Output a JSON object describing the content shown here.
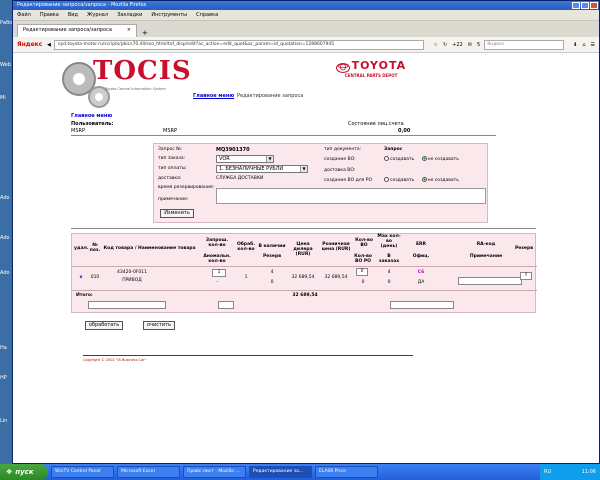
{
  "desktop": {
    "icons": [
      "Рабо",
      "Web",
      "Mi",
      "Ado",
      "Ado",
      "Ado",
      "На",
      "HP",
      "Lin"
    ]
  },
  "window": {
    "title": "Редактирование запроса/запроса - Mozilla Firefox"
  },
  "menu": [
    "Файл",
    "Правка",
    "Вид",
    "Журнал",
    "Закладки",
    "Инструменты",
    "Справка"
  ],
  "tab": {
    "label": "Редактирование запроса/запроса",
    "close": "×",
    "plus": "+"
  },
  "urlbar": {
    "logo": "Яндекс",
    "url": "cpd.toyota-motor.ru/scripts/pbics70.dll/sso_html/tof_disp/edit?ac_action=edit_quot&ac_param=id_quotation=1288607945",
    "count1": "+22",
    "count2": "5",
    "search_placeholder": "Яндекс"
  },
  "header": {
    "tocis": "TOCIS",
    "tocis_sub": "Toyota Central Information System",
    "toyota": "TOYOTA",
    "toyota_sub": "CENTRAL PARTS DEPOT",
    "nav_main": "Главное меню",
    "nav_edit": "Редактирование запроса"
  },
  "info": {
    "page_heading": "Главное меню",
    "users_label": "Пользователь:",
    "msrp_a": "MSRP",
    "msrp_b": "MSRP",
    "account_label": "Состояние лиц.счета",
    "account_value": "0,00"
  },
  "form": {
    "req_no_label": "Запрос №:",
    "req_no_value": "MQ3901370",
    "order_type_label": "тип заказа:",
    "order_type_value": "VOR",
    "payment_label": "тип оплаты:",
    "payment_value": "1. БЕЗНАЛИЧНЫЕ РУБЛИ",
    "delivery_label": "доставка:",
    "delivery_value": "СЛУЖБА ДОСТАВКИ",
    "reserve_time_label": "время резервирования:",
    "note_label": "примечание:",
    "doc_type_label": "тип документа:",
    "request_header": "Запрос",
    "created_bo_label": "создание ВО:",
    "delivery_bo_label": "доставка ВО:",
    "created_bo_po_label": "создание ВО для PO",
    "radio_create": "создавать",
    "radio_no_create": "не создавать",
    "change_button": "Изменить"
  },
  "table": {
    "headers": {
      "del": "удал.",
      "pos": "№ поз.",
      "code": "Код товара / Наименование товара",
      "req_qty": "Запрош. кол-во",
      "absent_qty": "Аномальн. кол-во",
      "proc_qty": "Обраб. кол-во",
      "available": "В наличии",
      "reserve": "Резерв",
      "price_dealer": "Цена дилера (RUR)",
      "retail_price": "Розничная цена (RUR)",
      "qty_bo": "Кол-во ВО",
      "qty_bo_po": "Кол-во ВО PO",
      "max_qty": "Max кол-во (день)",
      "in_order": "В заказах",
      "err": "ERR",
      "offc": "Офиц.",
      "ra_code": "RA-код",
      "note": "Примечание",
      "reserve2": "Резерв"
    },
    "row": {
      "del": "x",
      "pos": "010",
      "code": "43420-0F011",
      "name": "ПРИВОД",
      "req_qty": "1",
      "absent_qty": "-",
      "proc_qty": "1",
      "available": "4",
      "reserve": "0",
      "price_dealer": "32 689,54",
      "retail_price": "32 689,54",
      "qty_bo": "0",
      "qty_bo_po": "0",
      "max_qty": "4",
      "in_order": "0",
      "err": "C6",
      "offc": "ДА",
      "btn": "!"
    },
    "total_label": "Итого:",
    "total_value": "32 689,54"
  },
  "actions": {
    "process": "обработать",
    "clear": "очистить"
  },
  "footer": {
    "copyright": "Copyright © 2002 \"IA Business Car\""
  },
  "taskbar": {
    "start": "пуск",
    "tasks": [
      "WinTV Control Panel",
      "Microsoft Excel",
      "Прайс-лист - Mozilla ...",
      "Редактирование за...",
      "ELASK Price"
    ],
    "lang": "RU",
    "time": "11:06"
  }
}
